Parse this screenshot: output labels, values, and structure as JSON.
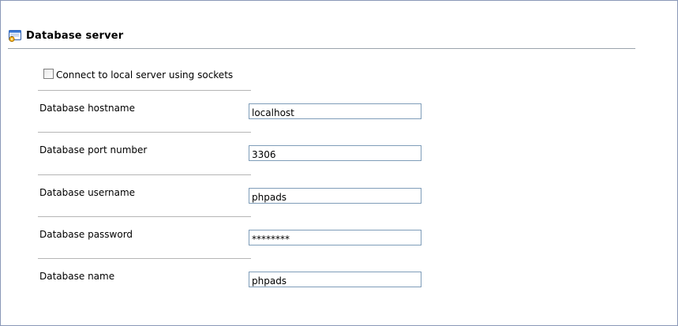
{
  "section": {
    "title": "Database server",
    "icon": "database-settings-icon"
  },
  "socket_option": {
    "label": "Connect to local server using sockets",
    "checked": false
  },
  "fields": [
    {
      "label": "Database hostname",
      "value": "localhost"
    },
    {
      "label": "Database port number",
      "value": "3306"
    },
    {
      "label": "Database username",
      "value": "phpads"
    },
    {
      "label": "Database password",
      "value": "********"
    },
    {
      "label": "Database name",
      "value": "phpads"
    }
  ],
  "colors": {
    "frame_border": "#8a98b8",
    "input_border": "#7f9db9",
    "separator": "#b5b5b5"
  }
}
